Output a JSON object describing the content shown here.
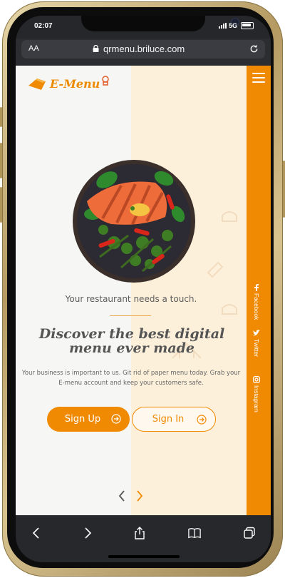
{
  "status_bar": {
    "time": "02:07",
    "network": "5G"
  },
  "browser": {
    "text_size_label": "AA",
    "url": "qrmenu.briluce.com"
  },
  "site": {
    "logo_text": "E-Menu",
    "tagline": "Your restaurant needs a touch.",
    "headline": "Discover the best digital menu ever made",
    "description": "Your business is important to us. Git rid of paper menu today. Grab your E-menu account and keep your customers safe.",
    "signup_label": "Sign Up",
    "signin_label": "Sign In",
    "social": [
      {
        "label": "Facebook",
        "icon": "facebook-icon"
      },
      {
        "label": "Twitter",
        "icon": "twitter-icon"
      },
      {
        "label": "Instagram",
        "icon": "instagram-icon"
      }
    ]
  },
  "colors": {
    "accent": "#ef8a02",
    "panel": "#fdf0db",
    "toolbar": "#26282c"
  }
}
